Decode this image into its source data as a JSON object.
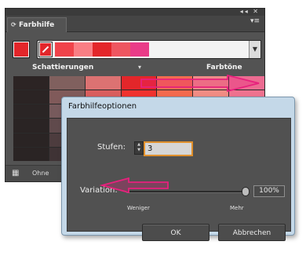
{
  "panel": {
    "title": "Farbhilfe",
    "tab_icon": "⟳",
    "top_controls": "◂◂ ✕",
    "menu_glyph": "▾≡",
    "column_headers": {
      "left": "Schattierungen",
      "right": "Farbtöne"
    },
    "column_menu_glyph": "▾",
    "bottom_icon": "▦",
    "bottom_label": "Ohne",
    "base_color": "#e3262a",
    "harmony_colors": [
      "#f0434a",
      "#f97e84",
      "#e3262a",
      "#ee5660",
      "#ea3b88"
    ],
    "grid": [
      [
        "#2c2424",
        "#80605e",
        "#dc7272",
        "#e3262a",
        "#f36d4f",
        "#ee8b88",
        "#ec6b91"
      ],
      [
        "#2b2424",
        "#805a5a",
        "#d95e5e",
        "#f0322f",
        "#f46a4e",
        "#f18c84",
        "#ef728f"
      ],
      [
        "#2b2525",
        "#775a5c",
        "#b84646",
        "#c21f23",
        "#c84436",
        "#b8605d",
        "#b55072"
      ],
      [
        "#2a2424",
        "#604a4c",
        "#923636",
        "#9a1a1d",
        "#a33a33",
        "#95504e",
        "#8f4660"
      ],
      [
        "#2a2424",
        "#4d3c3e",
        "#6d2a2c",
        "#781417",
        "#7f2d2a",
        "#723f3f",
        "#6e3951"
      ],
      [
        "#2a2424",
        "#3f3335",
        "#4f2224",
        "#5a1214",
        "#5e2422",
        "#553233",
        "#552d40"
      ]
    ]
  },
  "dialog": {
    "title": "Farbhilfeoptionen",
    "steps_label": "Stufen:",
    "steps_value": "3",
    "variation_label": "Variation:",
    "variation_value": 1.0,
    "variation_text": "100%",
    "less_label": "Weniger",
    "more_label": "Mehr",
    "ok_label": "OK",
    "cancel_label": "Abbrechen"
  },
  "colors": {
    "annotation_pink": "#e8217d",
    "focus_orange": "#e0902c",
    "dialog_frame": "#c4d8e8"
  }
}
